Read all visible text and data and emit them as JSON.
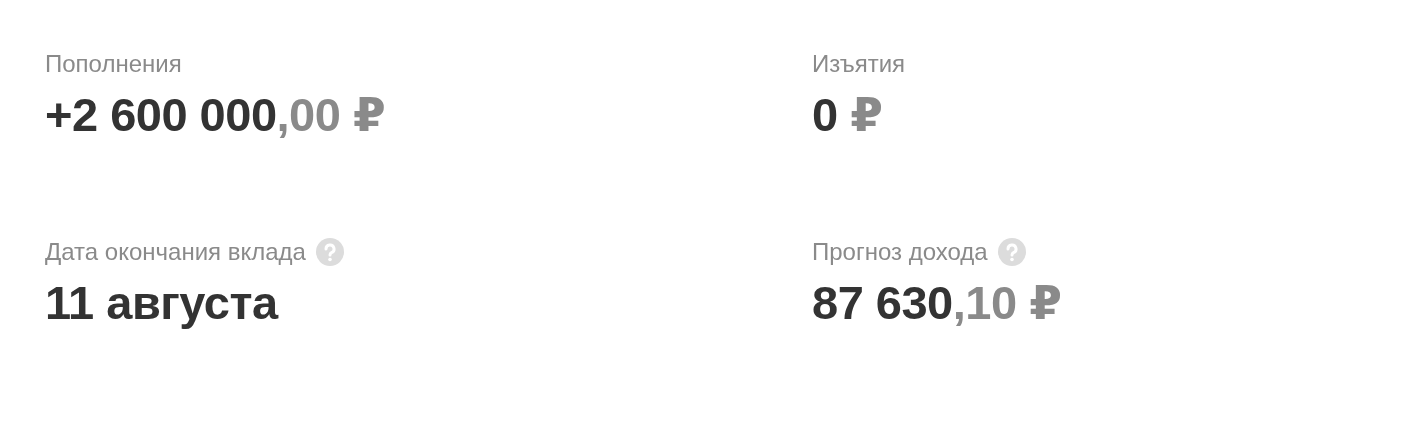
{
  "stats": [
    {
      "label": "Пополнения",
      "help": false,
      "value": {
        "main": "+2 600 000",
        "muted": ",00 ₽"
      }
    },
    {
      "label": "Изъятия",
      "help": false,
      "value": {
        "main": "0",
        "muted": " ₽"
      }
    },
    {
      "label": "Дата окончания вклада",
      "help": true,
      "value": {
        "main": "11 августа"
      }
    },
    {
      "label": "Прогноз дохода",
      "help": true,
      "value": {
        "main": "87 630",
        "muted": ",10 ₽"
      }
    }
  ]
}
